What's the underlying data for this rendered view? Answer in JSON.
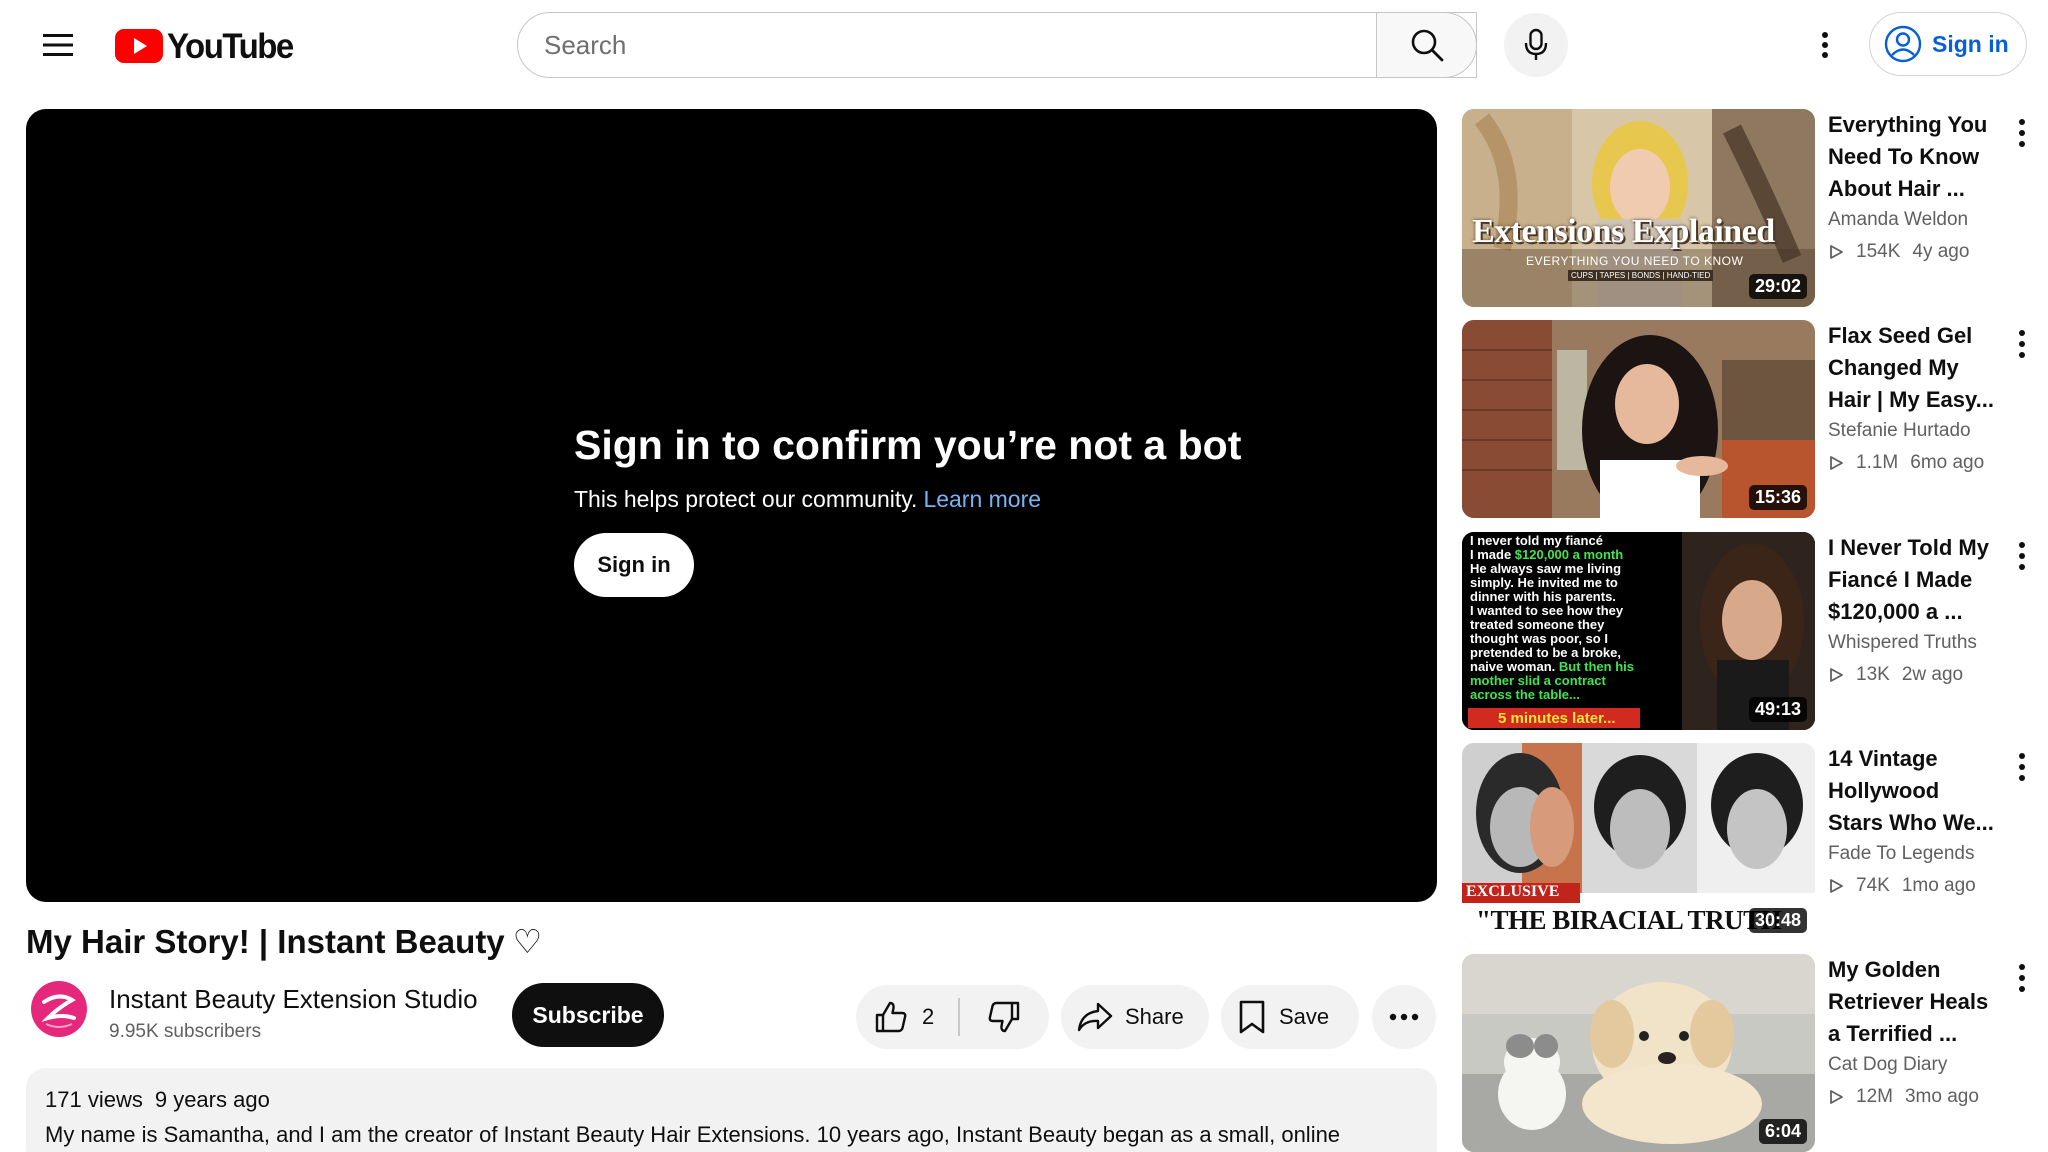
{
  "header": {
    "logo_text": "YouTube",
    "search_placeholder": "Search",
    "sign_in_label": "Sign in"
  },
  "player": {
    "heading": "Sign in to confirm you’re not a bot",
    "subtext": "This helps protect our community.",
    "learn_more": "Learn more",
    "sign_in_label": "Sign in"
  },
  "video": {
    "title": "My Hair Story! | Instant Beauty",
    "title_symbol": "♡",
    "channel_name": "Instant Beauty Extension Studio",
    "subscribers": "9.95K subscribers",
    "subscribe_label": "Subscribe",
    "like_count": "2",
    "share_label": "Share",
    "save_label": "Save",
    "views": "171 views",
    "age": "9 years ago",
    "description": "My name is Samantha, and I am the creator of Instant Beauty Hair Extensions. 10 years ago, Instant Beauty began as a small, online"
  },
  "recommendations": [
    {
      "title_lines": [
        "Everything You",
        "Need To Know",
        "About Hair ..."
      ],
      "channel": "Amanda Weldon",
      "views": "154K",
      "age": "4y ago",
      "duration": "29:02",
      "thumb_text": {
        "headline": "Extensions Explained",
        "sub1": "EVERYTHING YOU NEED TO KNOW",
        "sub2": "CUPS | TAPES | BONDS | HAND-TIED"
      }
    },
    {
      "title_lines": [
        "Flax Seed Gel",
        "Changed My",
        "Hair | My Easy..."
      ],
      "channel": "Stefanie Hurtado",
      "views": "1.1M",
      "age": "6mo ago",
      "duration": "15:36"
    },
    {
      "title_lines": [
        "I Never Told My",
        "Fiancé I Made",
        "$120,000 a ..."
      ],
      "channel": "Whispered Truths",
      "views": "13K",
      "age": "2w ago",
      "duration": "49:13",
      "thumb_text": {
        "l1": "I never told my fiancé",
        "l2a": "I made ",
        "l2b": "$120,000 a month",
        "l3": "He always saw me living",
        "l4": "simply. He invited me to",
        "l5": "dinner with his parents.",
        "l6": "I wanted to see how they",
        "l7": "treated someone they",
        "l8": "thought was poor, so I",
        "l9": "pretended to be a broke,",
        "l10a": "naive woman. ",
        "l10b": "But then his",
        "l11": "mother slid a contract",
        "l12": "across the table...",
        "banner": "5 minutes later..."
      }
    },
    {
      "title_lines": [
        "14 Vintage",
        "Hollywood",
        "Stars Who We..."
      ],
      "channel": "Fade To Legends",
      "views": "74K",
      "age": "1mo ago",
      "duration": "30:48",
      "thumb_text": {
        "tag": "EXCLUSIVE",
        "headline": "\"THE BIRACIAL TRUTH"
      }
    },
    {
      "title_lines": [
        "My Golden",
        "Retriever Heals",
        "a Terrified ..."
      ],
      "channel": "Cat Dog Diary",
      "views": "12M",
      "age": "3mo ago",
      "duration": "6:04"
    }
  ],
  "colors": {
    "brand_red": "#ff0000",
    "link_blue": "#065fd4",
    "player_link": "#7ab2f2"
  }
}
